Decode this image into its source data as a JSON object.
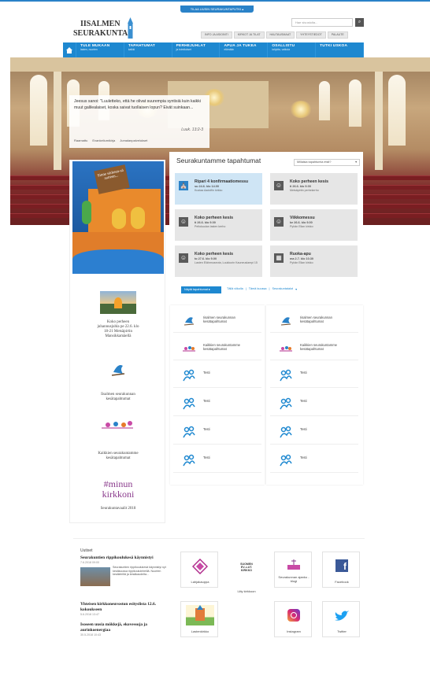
{
  "quick_bar": "TILAA UUSIN SEURAKUNTAPUTKI",
  "logo": {
    "line1": "IISALMEN",
    "line2": "SEURAKUNTA"
  },
  "search": {
    "placeholder": "Hae sivustolta..."
  },
  "secondary_nav": [
    "INFO JA ASIOINTI",
    "KIRKOT JA TILAT",
    "HAUTAUSMAAT",
    "YHTEYSTIEDOT",
    "PALAUTE"
  ],
  "main_nav": [
    {
      "title": "TULE MUKAAN",
      "sub": "lasten, nuorten"
    },
    {
      "title": "TAPAHTUMAT",
      "sub": "kaikki"
    },
    {
      "title": "PERHEJUHLAT",
      "sub": "ja toimitukset"
    },
    {
      "title": "APUA JA TUKEA",
      "sub": "elämään"
    },
    {
      "title": "OSALLISTU",
      "sub": "lahjoita, vaikuta"
    },
    {
      "title": "TUTKI USKOA",
      "sub": ""
    }
  ],
  "hero_quote": {
    "text": "Jeesus sanoi: \"Luuletteko, että he olivat suurempia syntisiä kuin kaikki muut galilealaiset, koska saivat tuollaisen lopun? Eivät suinkaan...",
    "ref": "Luuk. 13:2-3",
    "links": [
      "Raamattu",
      "Evankeliumikirja",
      "Jumalanpalvelukset"
    ]
  },
  "left_column": {
    "poster_text": "Sinne särkeen-sä aarteen...",
    "event_text": "Koko perheen juhannusjuhla pe 22.6. klo 18-21 Metsäpirtin Mansikkamäellä",
    "item1": "Iisalmen seurakunnan kesätapahtumat",
    "item2": "Kaikkien seurakuntamme kesätapahtumat",
    "minun_line1": "#minun",
    "minun_line2": "kirkkoni",
    "report": "Seurakuntavaalit 2018"
  },
  "events": {
    "title": "Seurakuntamme tapahtumat",
    "filter": "Millaisia tapahtumia etsit?",
    "items": [
      {
        "title": "Ripari 4 konfirmaatiomessu",
        "date": "su 24.6. klo 14.00",
        "place": "Kustaa Aadolfin kirkko",
        "icon": "church-icon",
        "highlight": true
      },
      {
        "title": "Koko perheen kesis",
        "date": "ti 26.6. klo 9.00",
        "place": "Metsäpirtin perhekerho",
        "icon": "family-icon",
        "highlight": false
      },
      {
        "title": "Koko perheen kesis",
        "date": "ti 26.6. klo 9.00",
        "place": "Peltokuulan lasten kerho",
        "icon": "family-icon",
        "highlight": false
      },
      {
        "title": "Viikkomessu",
        "date": "ke 26.6. klo 9.00",
        "place": "Pyhän Elian kirkko",
        "icon": "family-icon",
        "highlight": false
      },
      {
        "title": "Koko perheen kesis",
        "date": "to 27.6. klo 9.00",
        "place": "Lasten Eläinmuseota, Luukkurin Kauneuslampi 15",
        "icon": "family-icon",
        "highlight": false
      },
      {
        "title": "Ruoka-apu",
        "date": "ma 2.7. klo 10.30",
        "place": "Pyhän Elian kirkko",
        "icon": "food-icon",
        "highlight": false
      }
    ],
    "more_button": "Näytä tapahtumat",
    "links": [
      "Tällä viikolla",
      "Tämä kuussa",
      "Seurakuntatalot"
    ]
  },
  "tiles_left": [
    {
      "label": "Iisalmen seurakunnan kesätapahtumat",
      "icon": "bird-icon"
    },
    {
      "label": "Kaikkien seurakuntamme kesätapahtumat",
      "icon": "birds-icon"
    },
    {
      "label": "Testi",
      "icon": "people-icon"
    },
    {
      "label": "Testi",
      "icon": "people-icon"
    },
    {
      "label": "Testi",
      "icon": "people-icon"
    },
    {
      "label": "Testi",
      "icon": "people-icon"
    }
  ],
  "tiles_right": [
    {
      "label": "Iisalmen seurakunnan kesätapahtumat",
      "icon": "bird-icon"
    },
    {
      "label": "Kaikkien seurakuntamme kesätapahtumat",
      "icon": "birds-icon"
    },
    {
      "label": "Testi",
      "icon": "people-icon"
    },
    {
      "label": "Testi",
      "icon": "people-icon"
    },
    {
      "label": "Testi",
      "icon": "people-icon"
    },
    {
      "label": "Testi",
      "icon": "people-icon"
    }
  ],
  "news": {
    "heading": "Uutiset",
    "items": [
      {
        "title": "Seurakuntien rippikoulukesä käynnistyi",
        "date": "7.6.2018 09:00",
        "text": "Seurakuntien rippikoulukesä käynnistyi nyt kesäkuussa rippikoululeireillä. Nuorten kesäleiriltä ja kesäkaudelta..."
      },
      {
        "title": "Yhteisen kirkkoneuvoston esityslista 12.6. kokoukseen",
        "date": "5.6.2018 13:47",
        "text": ""
      },
      {
        "title": "Isoseen uusia mökkejä, ekovessoja ja aurinkoenergiaa",
        "date": "30.5.2018 10:43",
        "text": ""
      }
    ]
  },
  "footer_links": [
    {
      "label": "Lahjakauppa",
      "icon": "shop-icon"
    },
    {
      "label": "Liity kirkkoon",
      "icon": "church-join-icon"
    },
    {
      "label": "Seurakunnan ajanko -blogi",
      "icon": "blog-icon"
    },
    {
      "label": "Facebook",
      "icon": "facebook-icon"
    },
    {
      "label": "Lastenkirkko",
      "icon": "kids-church-icon"
    },
    {
      "label": "Instagram",
      "icon": "instagram-icon"
    },
    {
      "label": "Twitter",
      "icon": "twitter-icon"
    }
  ],
  "join_logo": {
    "line1": "SUOMEN",
    "line2": "EV.-LUT.",
    "line3": "KIRKKO"
  },
  "colors": {
    "brand_blue": "#1e88d0",
    "highlight": "#cfe5f5",
    "tile_gray": "#e6e6e6"
  }
}
